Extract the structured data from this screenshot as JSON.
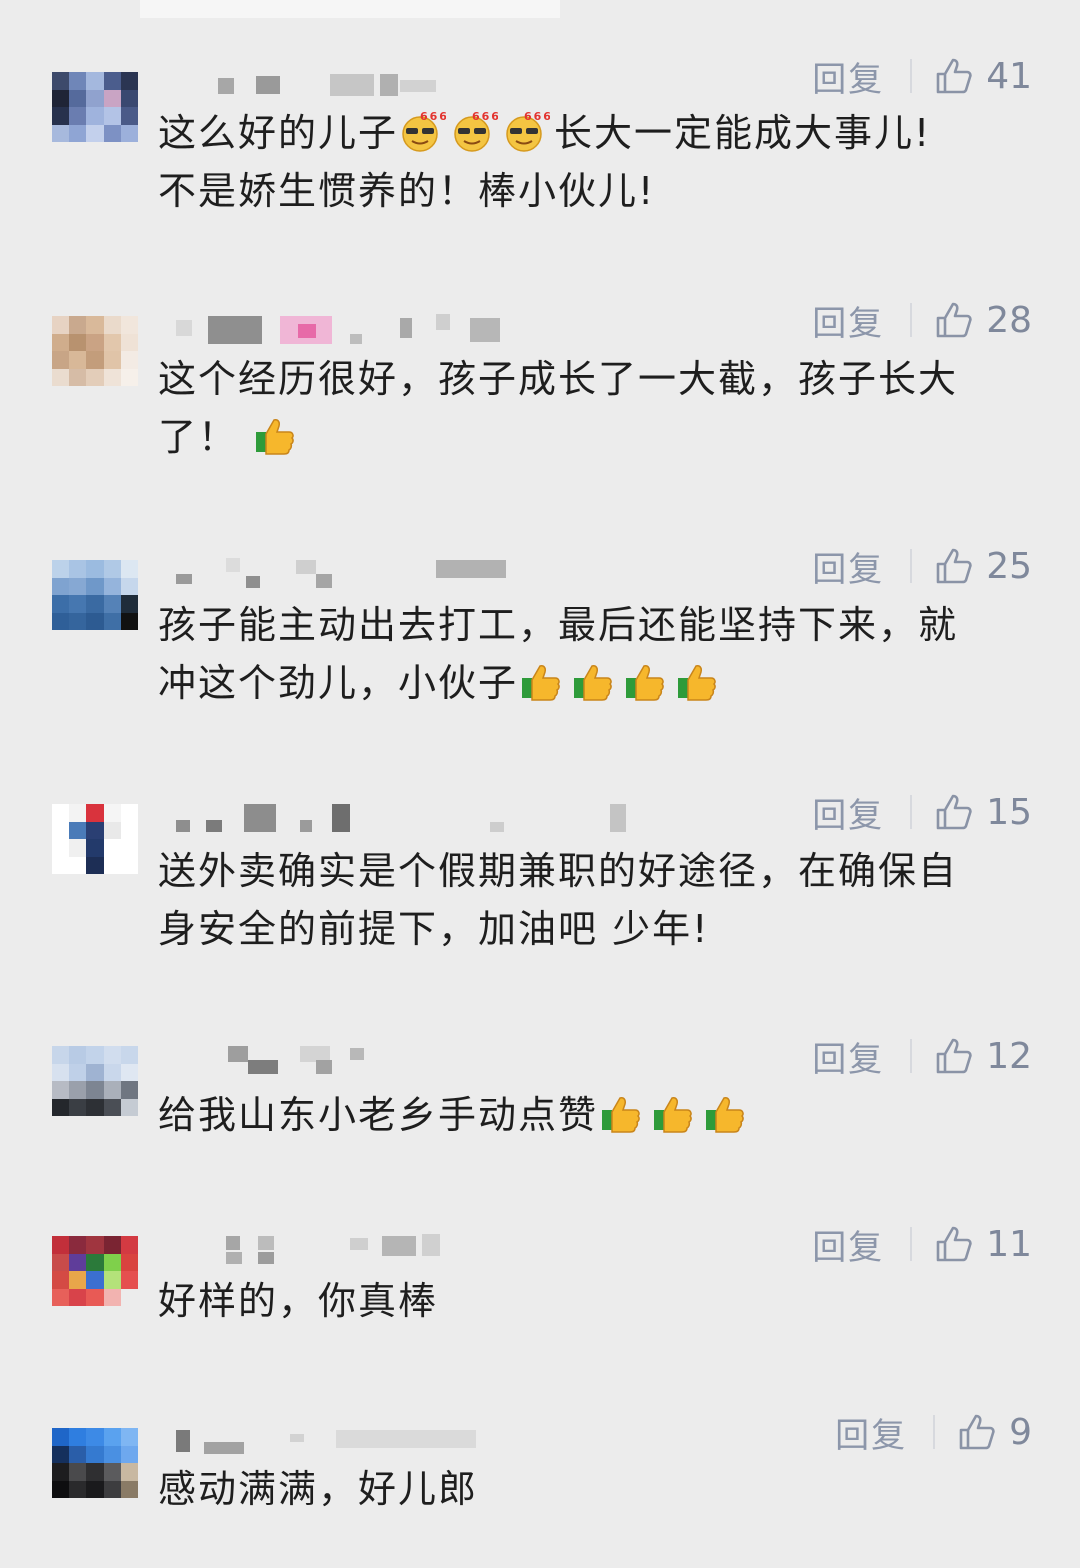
{
  "comments": [
    {
      "reply": "回复",
      "likes": "41",
      "line1": "这么好的儿子",
      "line1b": "长大一定能成大事儿!",
      "line2": "不是娇生惯养的！棒小伙儿!",
      "emoji": "666-sunglasses-emoji"
    },
    {
      "reply": "回复",
      "likes": "28",
      "line1": "这个经历很好，孩子成长了一大截，孩子长大",
      "line2": "了！",
      "emoji": "thumbs-up-emoji"
    },
    {
      "reply": "回复",
      "likes": "25",
      "line1": "孩子能主动出去打工，最后还能坚持下来，就",
      "line2": "冲这个劲儿，小伙子",
      "emoji": "thumbs-up-emoji"
    },
    {
      "reply": "回复",
      "likes": "15",
      "line1": "送外卖确实是个假期兼职的好途径，在确保自",
      "line2": "身安全的前提下，加油吧 少年!"
    },
    {
      "reply": "回复",
      "likes": "12",
      "line1": "给我山东小老乡手动点赞",
      "emoji": "thumbs-up-emoji"
    },
    {
      "reply": "回复",
      "likes": "11",
      "line1": "好样的，你真棒"
    },
    {
      "reply": "回复",
      "likes": "9",
      "line1": "感动满满，好儿郎"
    }
  ],
  "colors": {
    "background": "#ececec",
    "action_text": "#8a93a6",
    "comment_text": "#1e1e1e"
  }
}
